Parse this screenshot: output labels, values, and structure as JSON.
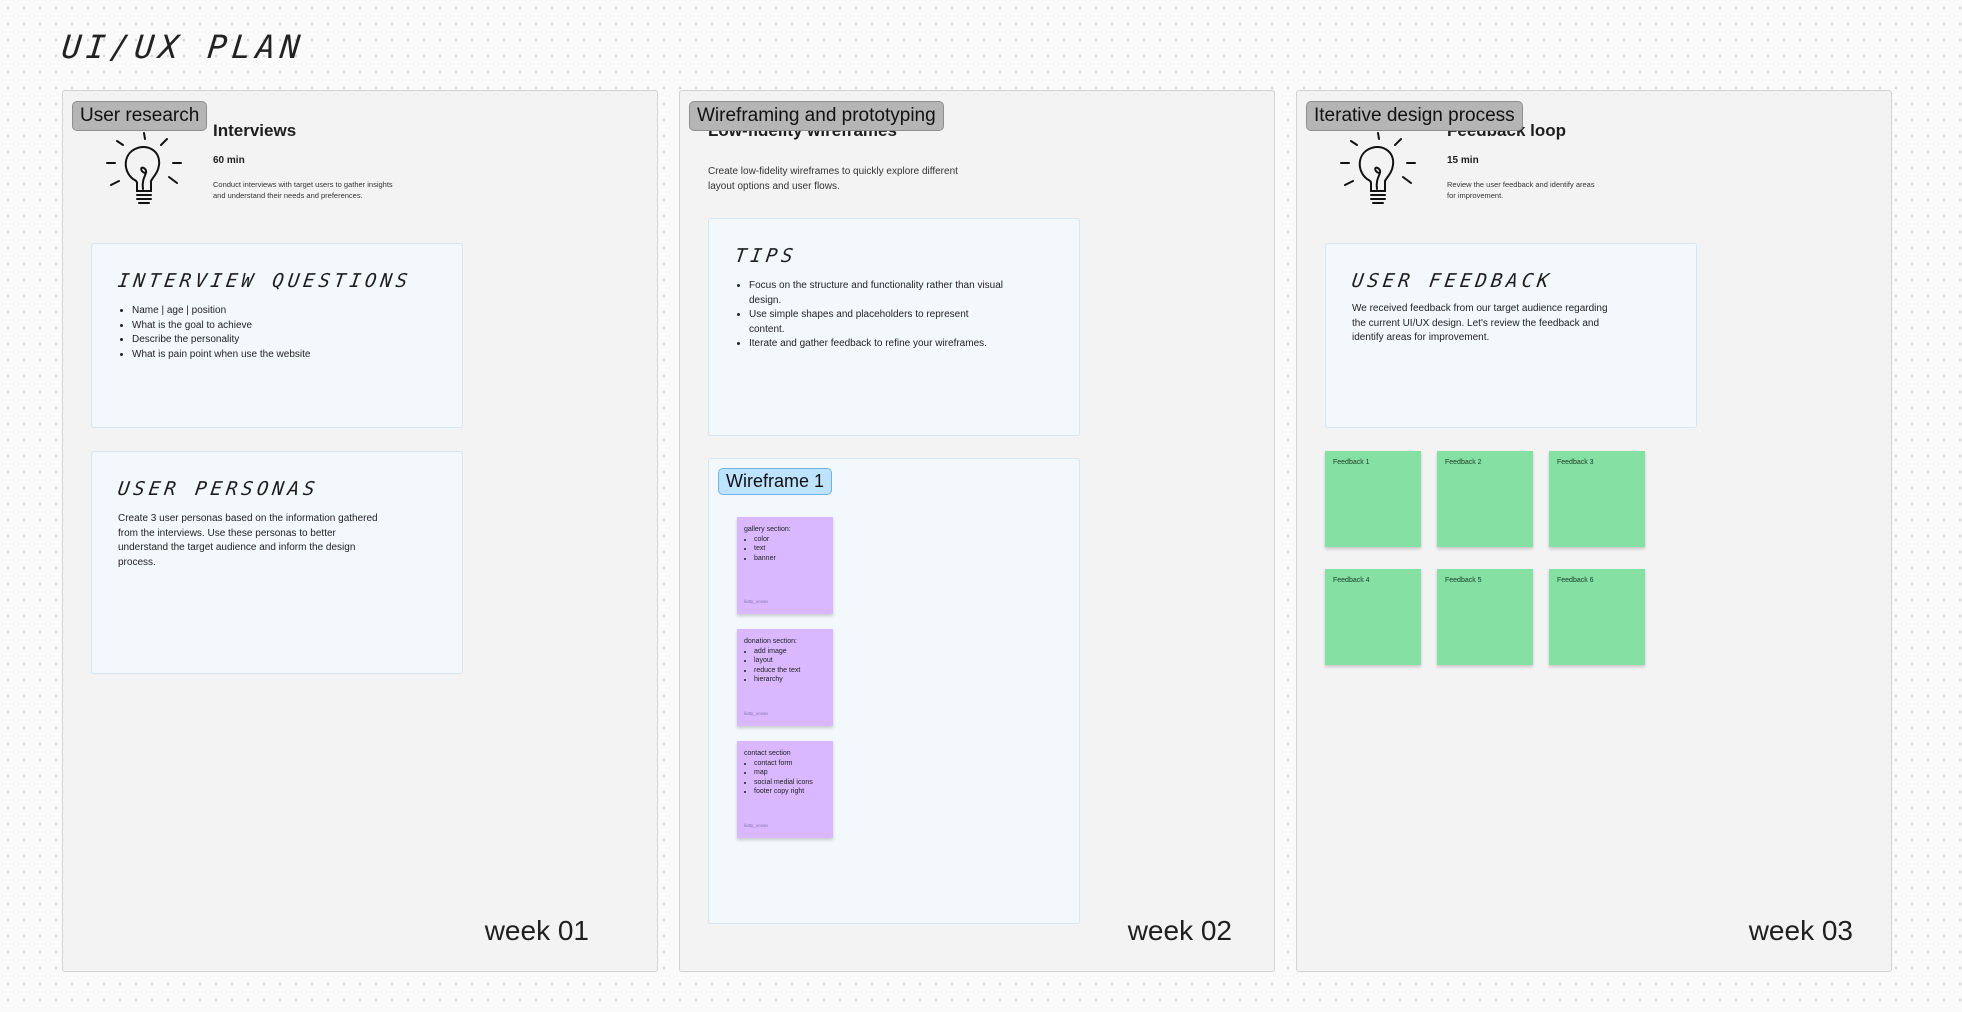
{
  "board": {
    "title": "UI/UX PLAN"
  },
  "sections": [
    {
      "tag": "User research",
      "week": "week 01",
      "task": {
        "title": "Interviews",
        "duration": "60 min",
        "description": "Conduct interviews with target users to gather insights and understand their needs and preferences."
      },
      "card1": {
        "heading": "INTERVIEW QUESTIONS",
        "items": [
          "Name | age | position",
          "What is the goal to achieve",
          "Describe the personality",
          "What is pain point when use the website"
        ]
      },
      "card2": {
        "heading": "USER PERSONAS",
        "text": "Create 3 user personas based on the information gathered from the interviews. Use these personas to better understand the target audience and inform the design process."
      }
    },
    {
      "tag": "Wireframing and prototyping",
      "week": "week 02",
      "task": {
        "title": "Low-fidelity wireframes",
        "description": "Create low-fidelity wireframes to quickly explore different layout options and user flows."
      },
      "tips": {
        "heading": "TIPS",
        "items": [
          "Focus on the structure and functionality rather than visual design.",
          "Use simple shapes and placeholders to represent content.",
          "Iterate and gather feedback to refine your wireframes."
        ]
      },
      "wireframe": {
        "tag": "Wireframe 1",
        "stickies": [
          {
            "title": "gallery section:",
            "items": [
              "color",
              "text",
              "banner"
            ],
            "author": "liutty_ocean"
          },
          {
            "title": "donation section:",
            "items": [
              "add image",
              "layout",
              "reduce the text",
              "hierarchy"
            ],
            "author": "liutty_ocean"
          },
          {
            "title": "contact section",
            "items": [
              "contact form",
              "map",
              "social medial icons",
              "footer copy right"
            ],
            "author": "liutty_ocean"
          }
        ]
      }
    },
    {
      "tag": "Iterative design process",
      "week": "week 03",
      "task": {
        "title": "Feedback loop",
        "duration": "15 min",
        "description": "Review the user feedback and identify areas for improvement."
      },
      "card1": {
        "heading": "USER FEEDBACK",
        "text": "We received feedback from our target audience regarding the current UI/UX design. Let's review the feedback and identify areas for improvement."
      },
      "stickies": [
        "Feedback 1",
        "Feedback 2",
        "Feedback 3",
        "Feedback 4",
        "Feedback 5",
        "Feedback 6"
      ]
    }
  ],
  "colors": {
    "section_bg": "#f3f3f3",
    "card_bg": "#f3f8fc",
    "sticky_purple": "#d9b8ff",
    "sticky_green": "#85e0a3",
    "tag_grey": "#b5b5b5",
    "tag_blue": "#bde3ff"
  }
}
